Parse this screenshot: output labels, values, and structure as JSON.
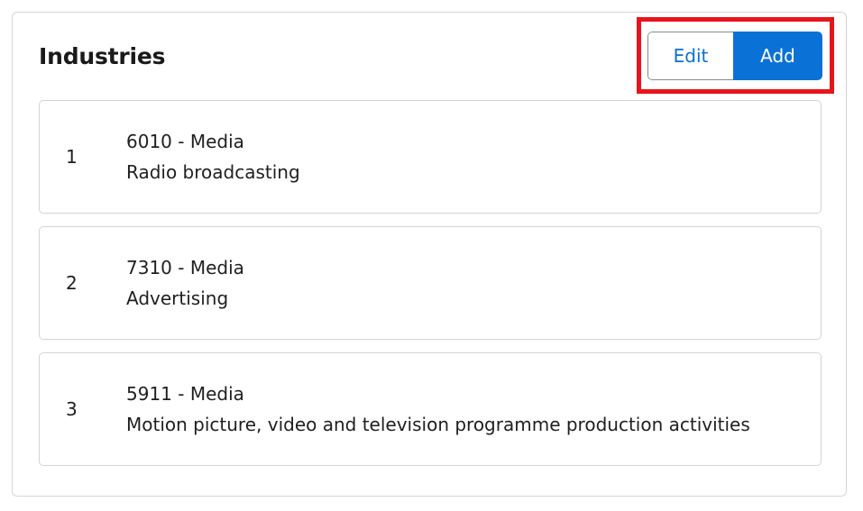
{
  "panel": {
    "title": "Industries",
    "edit_label": "Edit",
    "add_label": "Add"
  },
  "industries": [
    {
      "index": "1",
      "code": "6010 - Media",
      "description": "Radio broadcasting"
    },
    {
      "index": "2",
      "code": "7310 - Media",
      "description": "Advertising"
    },
    {
      "index": "3",
      "code": "5911 - Media",
      "description": "Motion picture, video and television programme production activities"
    }
  ],
  "colors": {
    "accent": "#0a72d6",
    "highlight": "#e8141b"
  }
}
